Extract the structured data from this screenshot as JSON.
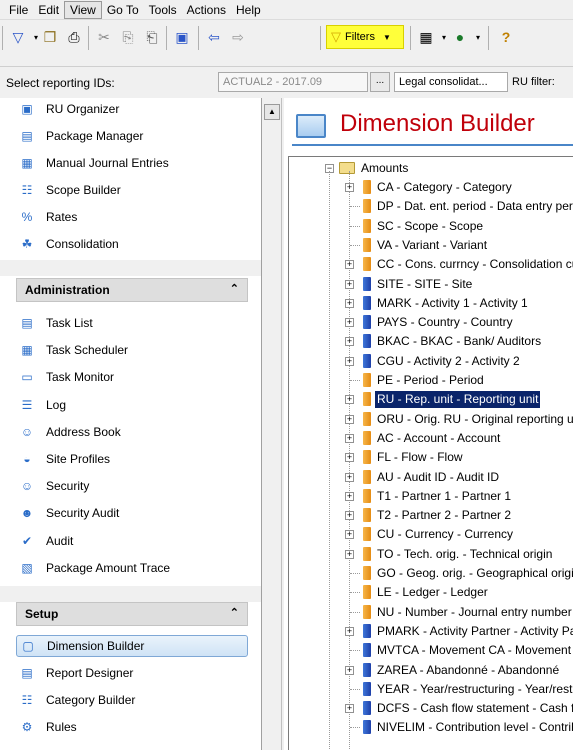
{
  "menu": [
    "File",
    "Edit",
    "View",
    "Go To",
    "Tools",
    "Actions",
    "Help"
  ],
  "menu_active_index": 2,
  "toolbar": {
    "filters_label": "Filters",
    "icons": [
      "filter-icon",
      "folder-open-icon",
      "print-icon",
      "cut-icon",
      "copy-icon",
      "paste-icon",
      "properties-icon",
      "back-arrow-icon",
      "forward-arrow-icon",
      "grid-icon",
      "globe-icon",
      "help-icon"
    ]
  },
  "reportbar": {
    "label": "Select reporting IDs:",
    "reporting_value": "ACTUAL2 - 2017.09",
    "browse_label": "...",
    "legal_value": "Legal consolidat...",
    "ru_filter_label": "RU filter:"
  },
  "nav_top": [
    {
      "label": "RU Organizer",
      "icon": "ru-organizer-icon",
      "glyph": "▣"
    },
    {
      "label": "Package Manager",
      "icon": "package-manager-icon",
      "glyph": "▤"
    },
    {
      "label": "Manual Journal Entries",
      "icon": "journal-icon",
      "glyph": "▦"
    },
    {
      "label": "Scope Builder",
      "icon": "scope-builder-icon",
      "glyph": "☷"
    },
    {
      "label": "Rates",
      "icon": "percent-icon",
      "glyph": "%"
    },
    {
      "label": "Consolidation",
      "icon": "consolidation-icon",
      "glyph": "☘"
    }
  ],
  "administration": {
    "title": "Administration",
    "items": [
      {
        "label": "Task List",
        "icon": "task-list-icon",
        "glyph": "▤"
      },
      {
        "label": "Task Scheduler",
        "icon": "task-scheduler-icon",
        "glyph": "▦"
      },
      {
        "label": "Task Monitor",
        "icon": "task-monitor-icon",
        "glyph": "▭"
      },
      {
        "label": "Log",
        "icon": "log-icon",
        "glyph": "☰"
      },
      {
        "label": "Address Book",
        "icon": "address-book-icon",
        "glyph": "☺"
      },
      {
        "label": "Site Profiles",
        "icon": "site-profiles-icon",
        "glyph": "◒"
      },
      {
        "label": "Security",
        "icon": "security-user-icon",
        "glyph": "☺"
      },
      {
        "label": "Security Audit",
        "icon": "security-audit-icon",
        "glyph": "☻"
      },
      {
        "label": "Audit",
        "icon": "audit-icon",
        "glyph": "✔"
      },
      {
        "label": "Package Amount Trace",
        "icon": "amount-trace-icon",
        "glyph": "▧"
      }
    ]
  },
  "setup": {
    "title": "Setup",
    "items": [
      {
        "label": "Dimension Builder",
        "icon": "dimension-builder-icon",
        "glyph": "▢",
        "selected": true
      },
      {
        "label": "Report Designer",
        "icon": "report-designer-icon",
        "glyph": "▤"
      },
      {
        "label": "Category Builder",
        "icon": "category-builder-icon",
        "glyph": "☷"
      },
      {
        "label": "Rules",
        "icon": "rules-gear-icon",
        "glyph": "⚙"
      }
    ]
  },
  "main": {
    "title": "Dimension Builder"
  },
  "tree": {
    "root": "Amounts",
    "items": [
      {
        "label": "CA - Category - Category",
        "color": "orange",
        "expandable": true
      },
      {
        "label": "DP - Dat. ent. period - Data entry period",
        "color": "orange",
        "expandable": false
      },
      {
        "label": "SC - Scope - Scope",
        "color": "orange",
        "expandable": false
      },
      {
        "label": "VA - Variant - Variant",
        "color": "orange",
        "expandable": false
      },
      {
        "label": "CC - Cons. currncy - Consolidation currency",
        "color": "orange",
        "expandable": true
      },
      {
        "label": "SITE - SITE - Site",
        "color": "blue",
        "expandable": true
      },
      {
        "label": "MARK - Activity 1 - Activity 1",
        "color": "blue",
        "expandable": true
      },
      {
        "label": "PAYS - Country - Country",
        "color": "blue",
        "expandable": true
      },
      {
        "label": "BKAC - BKAC - Bank/ Auditors",
        "color": "blue",
        "expandable": true
      },
      {
        "label": "CGU - Activity 2 - Activity 2",
        "color": "blue",
        "expandable": true
      },
      {
        "label": "PE - Period - Period",
        "color": "orange",
        "expandable": false
      },
      {
        "label": "RU - Rep. unit - Reporting unit",
        "color": "orange",
        "expandable": true,
        "selected": true
      },
      {
        "label": "ORU - Orig. RU - Original reporting unit",
        "color": "orange",
        "expandable": true
      },
      {
        "label": "AC - Account - Account",
        "color": "orange",
        "expandable": true
      },
      {
        "label": "FL - Flow - Flow",
        "color": "orange",
        "expandable": true
      },
      {
        "label": "AU - Audit ID - Audit ID",
        "color": "orange",
        "expandable": true
      },
      {
        "label": "T1 - Partner 1 - Partner 1",
        "color": "orange",
        "expandable": true
      },
      {
        "label": "T2 - Partner 2 - Partner 2",
        "color": "orange",
        "expandable": true
      },
      {
        "label": "CU - Currency - Currency",
        "color": "orange",
        "expandable": true
      },
      {
        "label": "TO - Tech. orig. - Technical origin",
        "color": "orange",
        "expandable": true
      },
      {
        "label": "GO - Geog. orig. - Geographical origin",
        "color": "orange",
        "expandable": false
      },
      {
        "label": "LE - Ledger - Ledger",
        "color": "orange",
        "expandable": false
      },
      {
        "label": "NU - Number - Journal entry number",
        "color": "orange",
        "expandable": false
      },
      {
        "label": "PMARK - Activity Partner - Activity Partner",
        "color": "blue",
        "expandable": true
      },
      {
        "label": "MVTCA - Movement CA - Movement CA",
        "color": "blue",
        "expandable": false
      },
      {
        "label": "ZAREA - Abandonné - Abandonné",
        "color": "blue",
        "expandable": true
      },
      {
        "label": "YEAR - Year/restructuring - Year/restructuring",
        "color": "blue",
        "expandable": false
      },
      {
        "label": "DCFS - Cash flow statement - Cash flow statement",
        "color": "blue",
        "expandable": true
      },
      {
        "label": "NIVELIM - Contribution level - Contribution level",
        "color": "blue",
        "expandable": false
      }
    ]
  }
}
